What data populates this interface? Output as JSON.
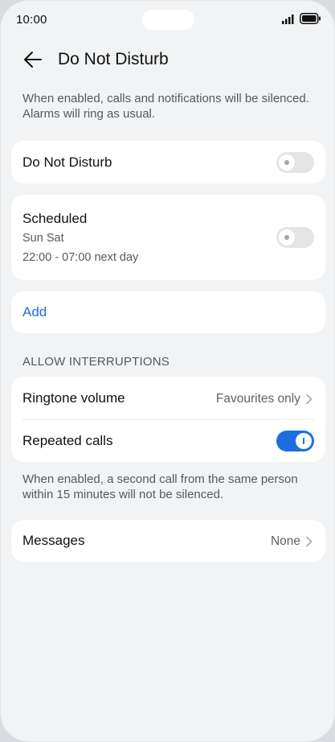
{
  "status_bar": {
    "time": "10:00"
  },
  "header": {
    "title": "Do Not Disturb"
  },
  "intro_text": "When enabled, calls and notifications will be silenced. Alarms will ring as usual.",
  "dnd": {
    "label": "Do Not Disturb",
    "enabled": false
  },
  "scheduled": {
    "label": "Scheduled",
    "days": "Sun Sat",
    "time_range": "22:00 - 07:00 next day",
    "enabled": false
  },
  "add": {
    "label": "Add"
  },
  "allow": {
    "section_title": "ALLOW INTERRUPTIONS",
    "ringtone": {
      "label": "Ringtone volume",
      "value": "Favourites only"
    },
    "repeated": {
      "label": "Repeated calls",
      "enabled": true
    },
    "repeated_note": "When enabled, a second call from the same person within 15 minutes will not be silenced."
  },
  "messages": {
    "label": "Messages",
    "value": "None"
  },
  "colors": {
    "accent": "#1f6ee0",
    "background": "#f1f3f5",
    "card": "#ffffff"
  }
}
